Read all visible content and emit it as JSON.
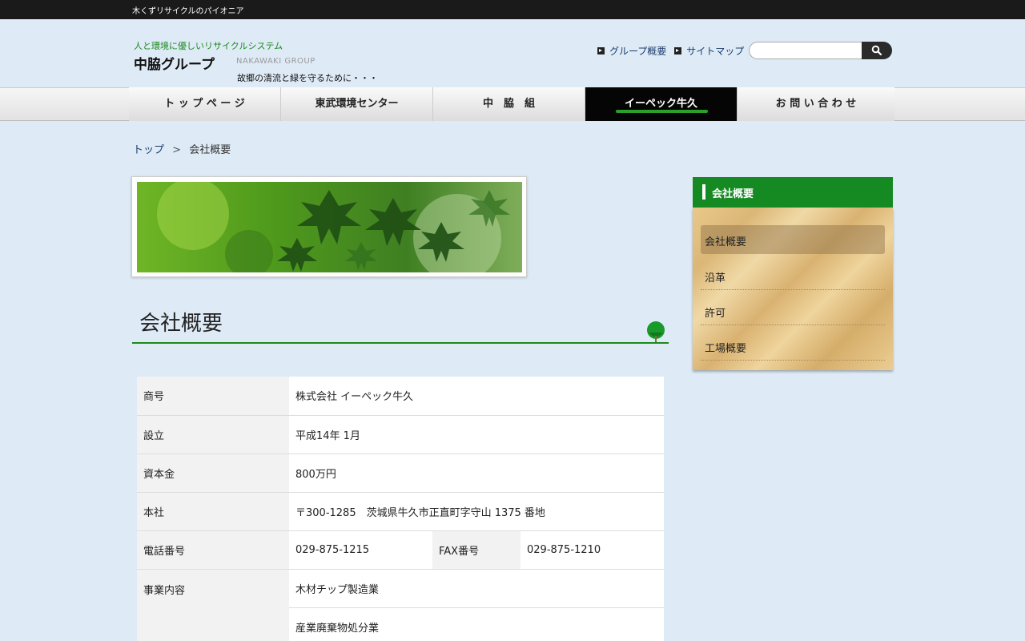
{
  "topbar": {
    "tagline": "木くずリサイクルのパイオニア"
  },
  "header": {
    "subtitle": "人と環境に優しいリサイクルシステム",
    "logo": "中脇グループ",
    "logo_en": "NAKAWAKI GROUP",
    "motto": "故郷の清流と緑を守るために・・・",
    "links": [
      "グループ概要",
      "サイトマップ"
    ],
    "search_placeholder": ""
  },
  "nav": {
    "items": [
      "ト ッ プ ペ ー ジ",
      "東武環境センター",
      "中　脇　組",
      "イーペック牛久",
      "お 問 い 合 わ せ"
    ],
    "active_index": 3
  },
  "breadcrumb": {
    "home": "トップ",
    "separator": ">",
    "current": "会社概要"
  },
  "page": {
    "title": "会社概要"
  },
  "company": {
    "rows": [
      {
        "label": "商号",
        "value": "株式会社 イーペック牛久"
      },
      {
        "label": "設立",
        "value": "平成14年 1月"
      },
      {
        "label": "資本金",
        "value": "800万円"
      },
      {
        "label": "本社",
        "value": "〒300-1285　茨城県牛久市正直町字守山 1375 番地"
      }
    ],
    "phone": {
      "label": "電話番号",
      "value": "029-875-1215",
      "fax_label": "FAX番号",
      "fax_value": "029-875-1210"
    },
    "business": {
      "label": "事業内容",
      "values": [
        "木材チップ製造業",
        "産業廃棄物処分業"
      ]
    }
  },
  "sidebar": {
    "heading": "会社概要",
    "items": [
      "会社概要",
      "沿革",
      "許可",
      "工場概要"
    ],
    "active_index": 0
  },
  "colors": {
    "accent_green": "#168a22",
    "nav_active": "#050505",
    "background": "#deebf7"
  }
}
